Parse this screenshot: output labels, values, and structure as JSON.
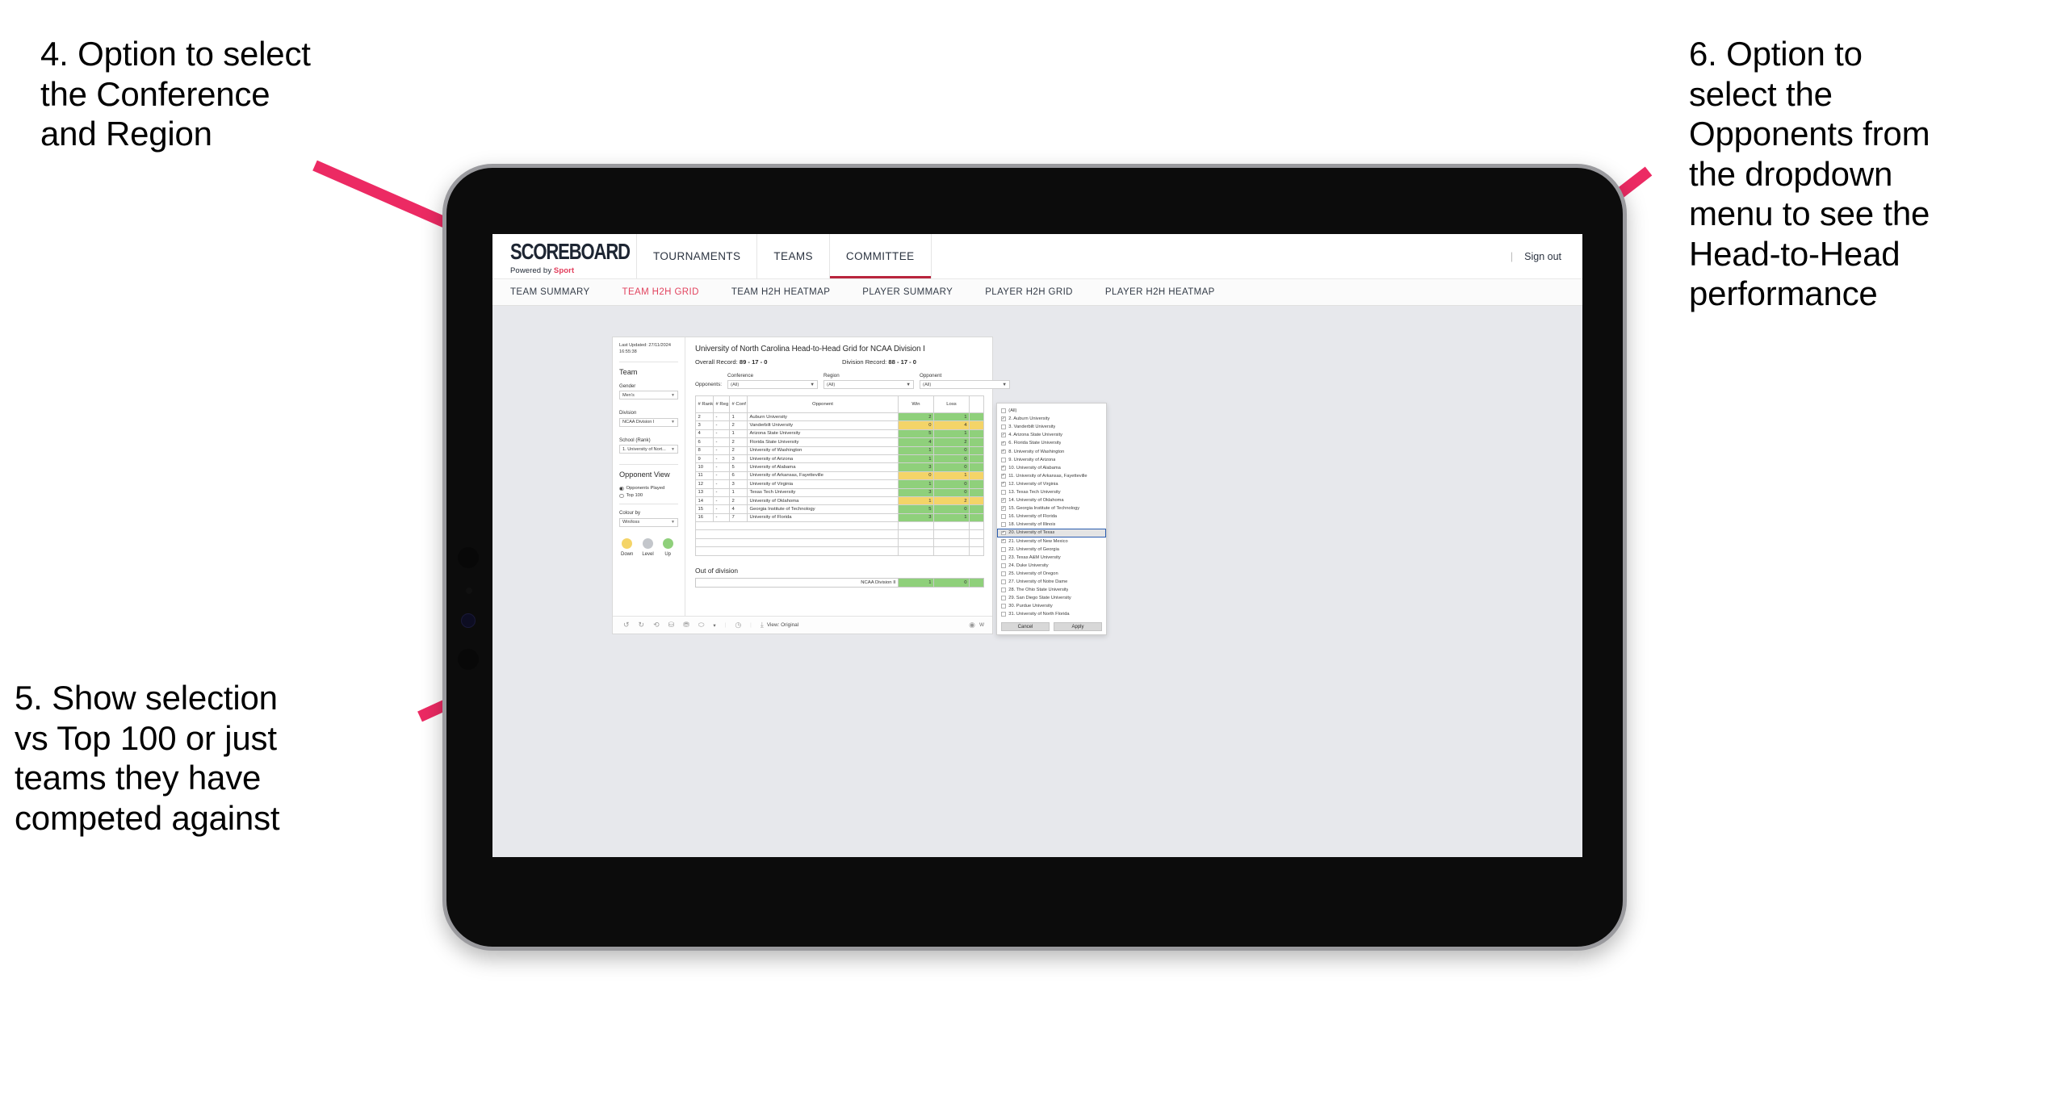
{
  "annotations": [
    {
      "id": "4",
      "text": "4. Option to select\nthe Conference\nand Region"
    },
    {
      "id": "5",
      "text": "5. Show selection\nvs Top 100 or just\nteams they have\ncompeted against"
    },
    {
      "id": "6",
      "text": "6. Option to\nselect the\nOpponents from\nthe dropdown\nmenu to see the\nHead-to-Head\nperformance"
    }
  ],
  "colors": {
    "arrow": "#EC2A63",
    "accent_red": "#E2445F",
    "nav_underline": "#B9253D",
    "win_green": "#8FD07B",
    "loss_yellow": "#F4D468",
    "level_grey": "#C3C6CB"
  },
  "app": {
    "brand": {
      "logo": "SCOREBOARD",
      "powered_prefix": "Powered by ",
      "powered_accent": "Sport"
    },
    "main_nav": [
      {
        "label": "TOURNAMENTS",
        "active": false
      },
      {
        "label": "TEAMS",
        "active": false
      },
      {
        "label": "COMMITTEE",
        "active": true
      }
    ],
    "sign_out": "Sign out",
    "sub_nav": [
      {
        "label": "TEAM SUMMARY",
        "active": false
      },
      {
        "label": "TEAM H2H GRID",
        "active": true
      },
      {
        "label": "TEAM H2H HEATMAP",
        "active": false
      },
      {
        "label": "PLAYER SUMMARY",
        "active": false
      },
      {
        "label": "PLAYER H2H GRID",
        "active": false
      },
      {
        "label": "PLAYER H2H HEATMAP",
        "active": false
      }
    ]
  },
  "sidebar": {
    "last_updated": "Last Updated: 27/11/2024 16:55:38",
    "team_title": "Team",
    "gender_label": "Gender",
    "gender_value": "Men's",
    "division_label": "Division",
    "division_value": "NCAA Division I",
    "school_label": "School (Rank)",
    "school_value": "1. University of Nort...",
    "opponent_view_title": "Opponent View",
    "opponent_view_options": [
      {
        "label": "Opponents Played",
        "selected": true
      },
      {
        "label": "Top 100",
        "selected": false
      }
    ],
    "colour_by_label": "Colour by",
    "colour_by_value": "Win/loss",
    "legend": [
      {
        "label": "Down",
        "color": "#F4D468"
      },
      {
        "label": "Level",
        "color": "#C3C6CB"
      },
      {
        "label": "Up",
        "color": "#8FD07B"
      }
    ]
  },
  "view": {
    "title": "University of North Carolina Head-to-Head Grid for NCAA Division I",
    "overall_record_label": "Overall Record: ",
    "overall_record_value": "89 - 17 - 0",
    "division_record_label": "Division Record: ",
    "division_record_value": "88 - 17 - 0",
    "opponents_lead": "Opponents:",
    "filters": [
      {
        "label": "Conference",
        "value": "(All)"
      },
      {
        "label": "Region",
        "value": "(All)"
      },
      {
        "label": "Opponent",
        "value": "(All)"
      }
    ],
    "out_of_division_title": "Out of division",
    "out_of_division_row": {
      "name": "NCAA Division II",
      "win": "1",
      "loss": "0"
    }
  },
  "chart_data": {
    "type": "table",
    "title": "University of North Carolina Head-to-Head Grid for NCAA Division I",
    "columns": [
      "# Rank",
      "# Reg",
      "# Conf",
      "Opponent",
      "Win",
      "Loss"
    ],
    "rows": [
      {
        "rank": "2",
        "reg": "-",
        "conf": "1",
        "opponent": "Auburn University",
        "win": "2",
        "loss": "1",
        "state": "up"
      },
      {
        "rank": "3",
        "reg": "-",
        "conf": "2",
        "opponent": "Vanderbilt University",
        "win": "0",
        "loss": "4",
        "state": "down"
      },
      {
        "rank": "4",
        "reg": "-",
        "conf": "1",
        "opponent": "Arizona State University",
        "win": "5",
        "loss": "1",
        "state": "up"
      },
      {
        "rank": "6",
        "reg": "-",
        "conf": "2",
        "opponent": "Florida State University",
        "win": "4",
        "loss": "2",
        "state": "up"
      },
      {
        "rank": "8",
        "reg": "-",
        "conf": "2",
        "opponent": "University of Washington",
        "win": "1",
        "loss": "0",
        "state": "up"
      },
      {
        "rank": "9",
        "reg": "-",
        "conf": "3",
        "opponent": "University of Arizona",
        "win": "1",
        "loss": "0",
        "state": "up"
      },
      {
        "rank": "10",
        "reg": "-",
        "conf": "5",
        "opponent": "University of Alabama",
        "win": "3",
        "loss": "0",
        "state": "up"
      },
      {
        "rank": "11",
        "reg": "-",
        "conf": "6",
        "opponent": "University of Arkansas, Fayetteville",
        "win": "0",
        "loss": "1",
        "state": "down"
      },
      {
        "rank": "12",
        "reg": "-",
        "conf": "3",
        "opponent": "University of Virginia",
        "win": "1",
        "loss": "0",
        "state": "up"
      },
      {
        "rank": "13",
        "reg": "-",
        "conf": "1",
        "opponent": "Texas Tech University",
        "win": "3",
        "loss": "0",
        "state": "up"
      },
      {
        "rank": "14",
        "reg": "-",
        "conf": "2",
        "opponent": "University of Oklahoma",
        "win": "1",
        "loss": "2",
        "state": "down"
      },
      {
        "rank": "15",
        "reg": "-",
        "conf": "4",
        "opponent": "Georgia Institute of Technology",
        "win": "5",
        "loss": "0",
        "state": "up"
      },
      {
        "rank": "16",
        "reg": "-",
        "conf": "7",
        "opponent": "University of Florida",
        "win": "3",
        "loss": "1",
        "state": "up"
      }
    ]
  },
  "dropdown": {
    "items": [
      {
        "label": "(All)",
        "checked": false,
        "selected": false
      },
      {
        "label": "2. Auburn University",
        "checked": true,
        "selected": false
      },
      {
        "label": "3. Vanderbilt University",
        "checked": false,
        "selected": false
      },
      {
        "label": "4. Arizona State University",
        "checked": true,
        "selected": false
      },
      {
        "label": "6. Florida State University",
        "checked": true,
        "selected": false
      },
      {
        "label": "8. University of Washington",
        "checked": true,
        "selected": false
      },
      {
        "label": "9. University of Arizona",
        "checked": false,
        "selected": false
      },
      {
        "label": "10. University of Alabama",
        "checked": true,
        "selected": false
      },
      {
        "label": "11. University of Arkansas, Fayetteville",
        "checked": true,
        "selected": false
      },
      {
        "label": "12. University of Virginia",
        "checked": true,
        "selected": false
      },
      {
        "label": "13. Texas Tech University",
        "checked": false,
        "selected": false
      },
      {
        "label": "14. University of Oklahoma",
        "checked": true,
        "selected": false
      },
      {
        "label": "15. Georgia Institute of Technology",
        "checked": true,
        "selected": false
      },
      {
        "label": "16. University of Florida",
        "checked": false,
        "selected": false
      },
      {
        "label": "18. University of Illinois",
        "checked": false,
        "selected": false
      },
      {
        "label": "20. University of Texas",
        "checked": true,
        "selected": true
      },
      {
        "label": "21. University of New Mexico",
        "checked": true,
        "selected": false
      },
      {
        "label": "22. University of Georgia",
        "checked": false,
        "selected": false
      },
      {
        "label": "23. Texas A&M University",
        "checked": false,
        "selected": false
      },
      {
        "label": "24. Duke University",
        "checked": false,
        "selected": false
      },
      {
        "label": "25. University of Oregon",
        "checked": false,
        "selected": false
      },
      {
        "label": "27. University of Notre Dame",
        "checked": false,
        "selected": false
      },
      {
        "label": "28. The Ohio State University",
        "checked": false,
        "selected": false
      },
      {
        "label": "29. San Diego State University",
        "checked": false,
        "selected": false
      },
      {
        "label": "30. Purdue University",
        "checked": false,
        "selected": false
      },
      {
        "label": "31. University of North Florida",
        "checked": false,
        "selected": false
      }
    ],
    "cancel": "Cancel",
    "apply": "Apply"
  },
  "toolbar": {
    "view_label": "View: Original",
    "watch_label": "W"
  }
}
